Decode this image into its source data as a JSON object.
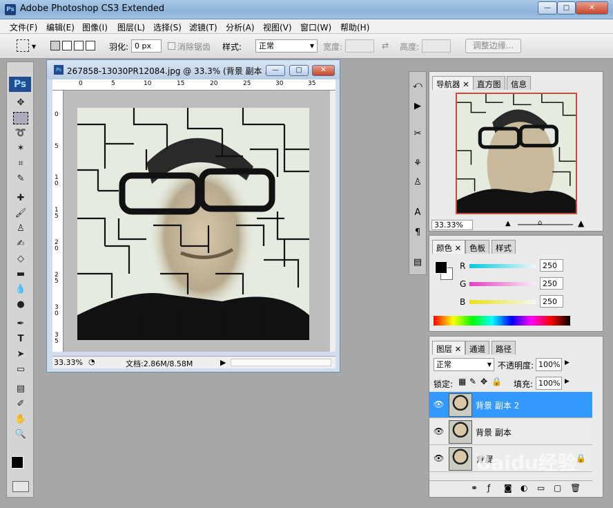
{
  "app": {
    "title": "Adobe Photoshop CS3 Extended",
    "icon_text": "Ps"
  },
  "window_buttons": {
    "minimize": "—",
    "maximize": "□",
    "close": "✕"
  },
  "menus": [
    "文件(F)",
    "编辑(E)",
    "图像(I)",
    "图层(L)",
    "选择(S)",
    "滤镜(T)",
    "分析(A)",
    "视图(V)",
    "窗口(W)",
    "帮助(H)"
  ],
  "options": {
    "feather_label": "羽化:",
    "feather_value": "0 px",
    "antialias_label": "消除锯齿",
    "style_label": "样式:",
    "style_value": "正常",
    "width_label": "宽度:",
    "height_label": "高度:",
    "refine_button": "调整边缘..."
  },
  "toolbox": {
    "logo": "Ps"
  },
  "document": {
    "title": "267858-13030PR12084.jpg @ 33.3% (背景 副本 ...",
    "zoom": "33.33%",
    "doc_size": "文档:2.86M/8.58M",
    "ruler_top": [
      "0",
      "5",
      "10",
      "15",
      "20",
      "25",
      "30",
      "35"
    ],
    "ruler_left": [
      "0",
      "5",
      "1\n0",
      "1\n5",
      "2\n0",
      "2\n5",
      "3\n0",
      "3\n5"
    ]
  },
  "navigator": {
    "tabs": [
      "导航器",
      "直方图",
      "信息"
    ],
    "zoom": "33.33%"
  },
  "color_panel": {
    "tabs": [
      "颜色",
      "色板",
      "样式"
    ],
    "channels": [
      {
        "label": "R",
        "value": "250",
        "color": "#00c8e0"
      },
      {
        "label": "G",
        "value": "250",
        "color": "#e040c0"
      },
      {
        "label": "B",
        "value": "250",
        "color": "#e8e020"
      }
    ]
  },
  "layers_panel": {
    "tabs": [
      "图层",
      "通道",
      "路径"
    ],
    "blend_mode": "正常",
    "opacity_label": "不透明度:",
    "opacity_value": "100%",
    "lock_label": "锁定:",
    "fill_label": "填充:",
    "fill_value": "100%",
    "layers": [
      {
        "name": "背景 副本 2",
        "selected": true
      },
      {
        "name": "背景 副本",
        "selected": false
      },
      {
        "name": "背景",
        "selected": false
      }
    ]
  },
  "watermark": "Baidu经验"
}
